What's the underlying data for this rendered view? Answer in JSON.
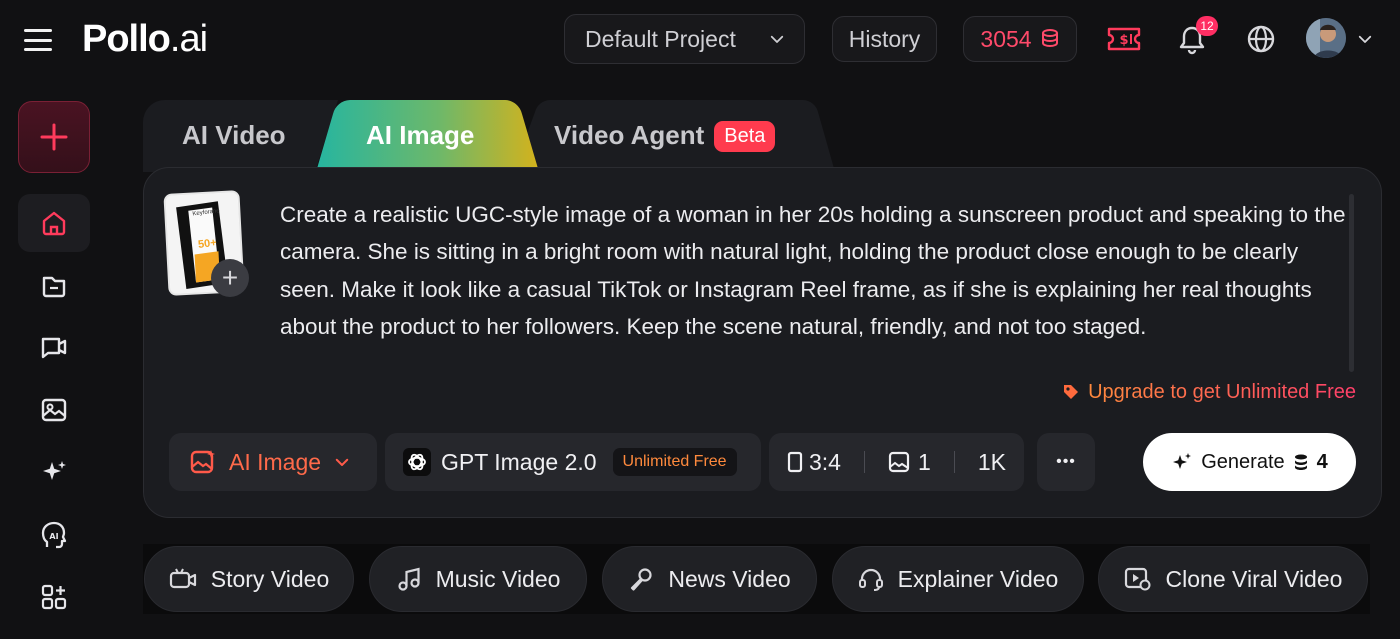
{
  "brand": {
    "logo_main": "Pollo",
    "logo_suffix": ".ai"
  },
  "topbar": {
    "project_label": "Default Project",
    "history_label": "History",
    "credits_value": "3054",
    "notifications_count": "12",
    "icons": [
      "menu-icon",
      "chevron-down-icon",
      "coins-icon",
      "ticket-icon",
      "bell-icon",
      "globe-icon",
      "avatar"
    ]
  },
  "sidebar": {
    "items": [
      {
        "name": "new-create-icon"
      },
      {
        "name": "home-icon",
        "active": true
      },
      {
        "name": "folder-icon"
      },
      {
        "name": "video-chat-icon"
      },
      {
        "name": "image-icon"
      },
      {
        "name": "sparkles-icon"
      },
      {
        "name": "ai-head-icon"
      },
      {
        "name": "apps-icon"
      }
    ]
  },
  "tabs": [
    {
      "label": "AI Video"
    },
    {
      "label": "AI Image",
      "active": true
    },
    {
      "label": "Video Agent",
      "badge": "Beta"
    }
  ],
  "composer": {
    "prompt": "Create a realistic UGC-style image of a woman in her 20s holding a sunscreen product and speaking to the camera. She is sitting in a bright room with natural light, holding the product close enough to be clearly seen. Make it look like a casual TikTok or Instagram Reel frame, as if she is explaining her real thoughts about the product to her followers. Keep the scene natural, friendly, and not too staged.",
    "thumbnail_brand_text": "Keyforane",
    "thumbnail_spf_text": "50+",
    "upgrade_text": "Upgrade to get Unlimited Free",
    "mode_label": "AI Image",
    "model_label": "GPT Image 2.0",
    "model_badge": "Unlimited Free",
    "aspect_ratio": "3:4",
    "image_count": "1",
    "resolution": "1K",
    "more_label": "•••",
    "generate_label": "Generate",
    "generate_cost": "4"
  },
  "quick_actions": [
    {
      "label": "Story Video"
    },
    {
      "label": "Music Video"
    },
    {
      "label": "News Video"
    },
    {
      "label": "Explainer Video"
    },
    {
      "label": "Clone Viral Video"
    }
  ],
  "colors": {
    "accent": "#ff3b5c",
    "accent_orange": "#ff7a3d",
    "background": "#111113",
    "panel": "#1b1c20",
    "tab_gradient_start": "#2bb39a",
    "tab_gradient_end": "#c9b41f"
  }
}
